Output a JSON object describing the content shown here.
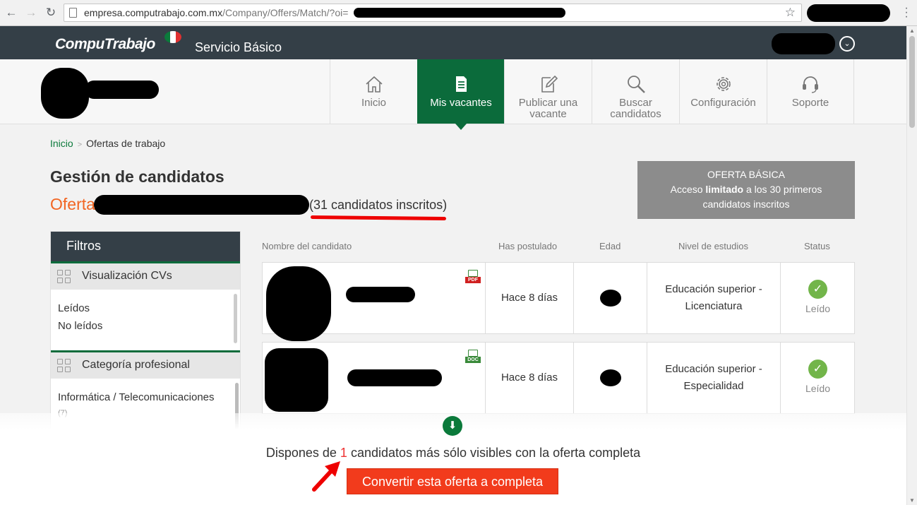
{
  "browser": {
    "url_host": "empresa.computrabajo.com.mx",
    "url_path": "/Company/Offers/Match/?oi="
  },
  "header": {
    "logo": "CompuTrabajo",
    "service": "Servicio Básico"
  },
  "nav": {
    "items": [
      {
        "label": "Inicio",
        "icon": "home-icon"
      },
      {
        "label": "Mis vacantes",
        "icon": "document-icon"
      },
      {
        "label": "Publicar una vacante",
        "icon": "edit-icon"
      },
      {
        "label": "Buscar candidatos",
        "icon": "search-icon"
      },
      {
        "label": "Configuración",
        "icon": "gear-icon"
      },
      {
        "label": "Soporte",
        "icon": "headset-icon"
      }
    ],
    "active": "Mis vacantes"
  },
  "breadcrumb": {
    "home": "Inicio",
    "separator": ">",
    "current": "Ofertas de trabajo"
  },
  "page": {
    "title": "Gestión de candidatos",
    "offer_prefix": "Oferta",
    "candidate_count": "(31 candidatos inscritos)"
  },
  "basic_offer": {
    "title": "OFERTA BÁSICA",
    "line1_pre": "Acceso ",
    "line1_bold": "limitado",
    "line1_post": " a los 30 primeros",
    "line2": "candidatos inscritos"
  },
  "filters": {
    "title": "Filtros",
    "sections": [
      {
        "title": "Visualización CVs",
        "options": [
          "Leídos",
          "No leídos"
        ]
      },
      {
        "title": "Categoría profesional",
        "options": [
          "Informática / Telecomunicaciones"
        ],
        "counts": [
          "(7)"
        ]
      }
    ]
  },
  "table": {
    "headers": [
      "Nombre del candidato",
      "Has postulado",
      "Edad",
      "Nivel de estudios",
      "Status"
    ],
    "rows": [
      {
        "file_type": "PDF",
        "applied": "Hace 8 días",
        "education_1": "Educación superior -",
        "education_2": "Licenciatura",
        "status": "Leído"
      },
      {
        "file_type": "DOC",
        "applied": "Hace 8 días",
        "education_1": "Educación superior -",
        "education_2": "Especialidad",
        "status": "Leído"
      }
    ]
  },
  "upsell": {
    "text_pre": "Dispones de ",
    "count": "1",
    "text_post": " candidatos más sólo visibles con la oferta completa",
    "button": "Convertir esta oferta a completa"
  },
  "colors": {
    "brand_dark": "#343f47",
    "brand_green": "#0b6b3b",
    "offer_orange": "#f26522",
    "cta_red": "#f23b1c",
    "status_green": "#72b54a"
  }
}
